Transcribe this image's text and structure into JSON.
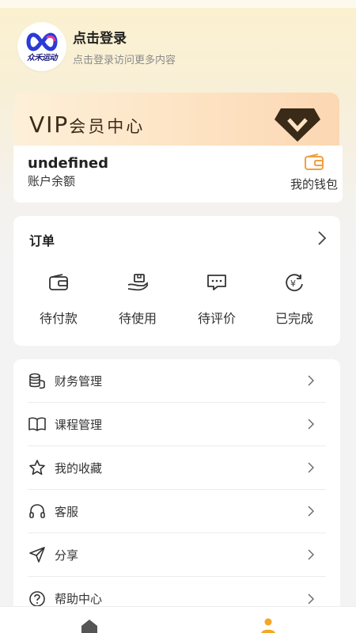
{
  "profile": {
    "brand_text": "众禾运动",
    "login_title": "点击登录",
    "login_subtitle": "点击登录访问更多内容"
  },
  "vip": {
    "title_latin": "VIP",
    "title_cn": "会员中心"
  },
  "wallet_card": {
    "balance_value": "undefined",
    "balance_label": "账户余额",
    "wallet_label": "我的钱包"
  },
  "orders": {
    "title": "订单",
    "items": [
      {
        "label": "待付款",
        "icon": "wallet-icon"
      },
      {
        "label": "待使用",
        "icon": "hand-box-icon"
      },
      {
        "label": "待评价",
        "icon": "comment-icon"
      },
      {
        "label": "已完成",
        "icon": "yen-refresh-icon"
      }
    ]
  },
  "menu": {
    "items": [
      {
        "label": "财务管理",
        "icon": "coins-icon"
      },
      {
        "label": "课程管理",
        "icon": "book-icon"
      },
      {
        "label": "我的收藏",
        "icon": "star-icon"
      },
      {
        "label": "客服",
        "icon": "headphones-icon"
      },
      {
        "label": "分享",
        "icon": "send-icon"
      },
      {
        "label": "帮助中心",
        "icon": "help-icon"
      }
    ]
  },
  "tabbar": {
    "tabs": [
      {
        "icon": "home-icon",
        "active": false
      },
      {
        "icon": "user-icon",
        "active": true
      }
    ]
  },
  "colors": {
    "accent": "#f5a623",
    "vip_text": "#3a2a18",
    "wallet_icon": "#f0a040"
  }
}
